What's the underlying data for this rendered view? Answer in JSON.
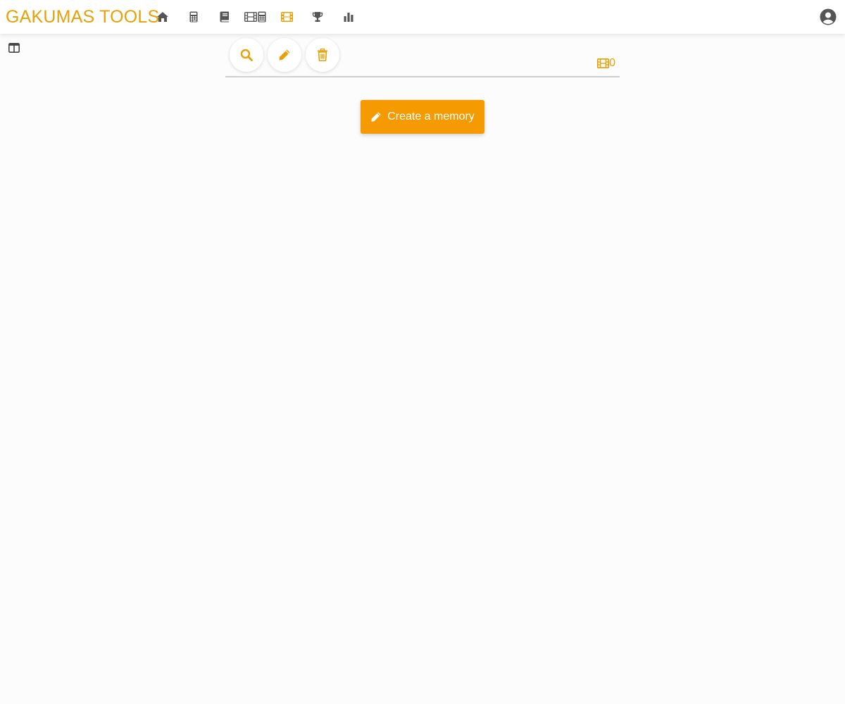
{
  "app": {
    "brand": "GAKUMAS TOOLS"
  },
  "nav": {
    "items": [
      {
        "icon": "home-icon",
        "active": false
      },
      {
        "icon": "calculator-icon",
        "active": false
      },
      {
        "icon": "book-icon",
        "active": false
      },
      {
        "icon": "film-calculator-icon",
        "active": false
      },
      {
        "icon": "film-icon",
        "active": true
      },
      {
        "icon": "trophy-icon",
        "active": false
      },
      {
        "icon": "bar-chart-icon",
        "active": false
      }
    ],
    "account_icon": "account-circle-icon"
  },
  "toolbar": {
    "buttons": [
      {
        "icon": "search-icon"
      },
      {
        "icon": "pencil-icon"
      },
      {
        "icon": "trash-icon"
      }
    ],
    "memory_count": "0"
  },
  "main": {
    "create_label": "Create a memory"
  },
  "colors": {
    "accent": "#e8a007",
    "button": "#f59a00",
    "nav_icon": "#555555"
  }
}
